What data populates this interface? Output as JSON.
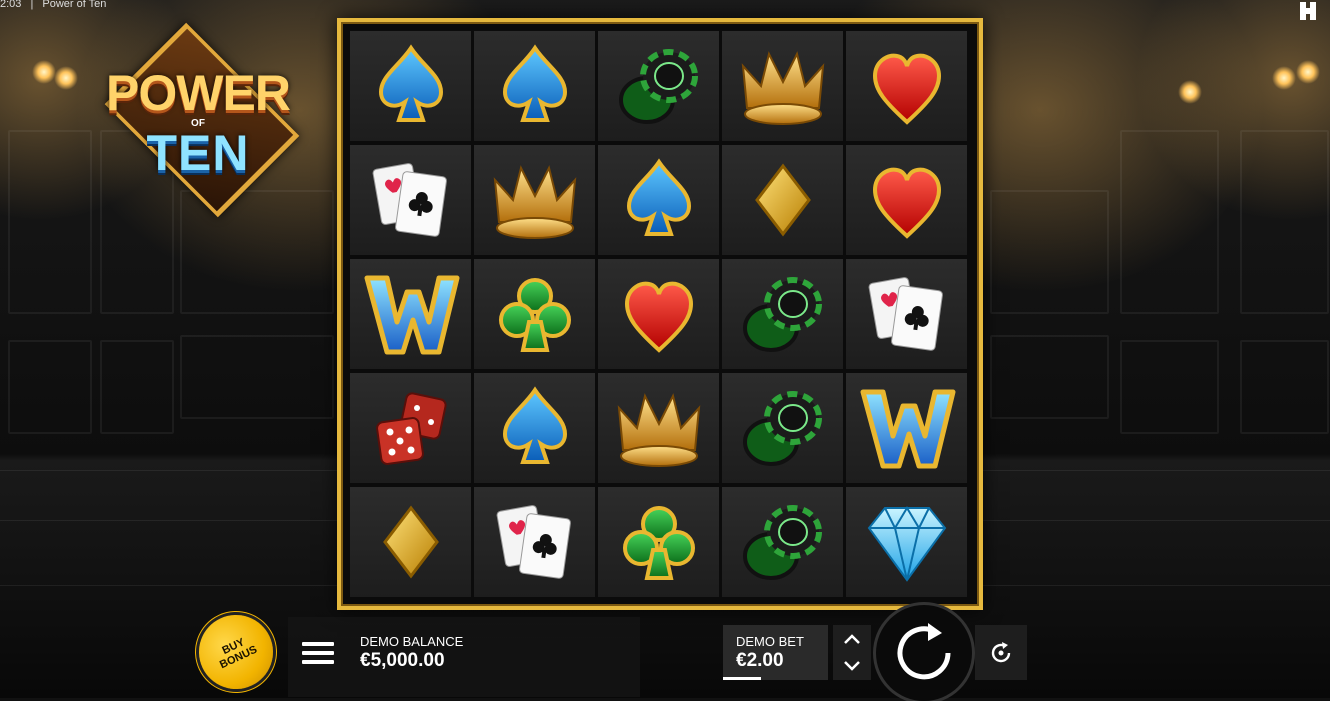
{
  "topbar": {
    "time": "2:03",
    "separator": "|",
    "title": "Power of Ten"
  },
  "logo": {
    "line1": "POWER",
    "line2": "OF",
    "line3": "TEN"
  },
  "grid": [
    [
      "spade",
      "spade",
      "chips",
      "crown",
      "heart"
    ],
    [
      "cards",
      "crown",
      "spade",
      "diamond",
      "heart"
    ],
    [
      "wild",
      "club",
      "heart",
      "chips",
      "cards"
    ],
    [
      "dice",
      "spade",
      "crown",
      "chips",
      "wild"
    ],
    [
      "diamond",
      "cards",
      "club",
      "chips",
      "gem"
    ]
  ],
  "controls": {
    "buy_bonus_line1": "BUY",
    "buy_bonus_line2": "BONUS",
    "balance_label": "DEMO BALANCE",
    "balance_value": "€5,000.00",
    "bet_label": "DEMO BET",
    "bet_value": "€2.00",
    "icons": [
      "menu-icon",
      "chevron-up-icon",
      "chevron-down-icon",
      "spin-icon",
      "autoplay-icon"
    ]
  },
  "colors": {
    "frame": "#e6b93e",
    "buy_bonus": "#f2b400",
    "spade": "#1e8fe0",
    "heart": "#e01a1a",
    "club": "#1f9a2a",
    "gold": "#e9b730"
  }
}
